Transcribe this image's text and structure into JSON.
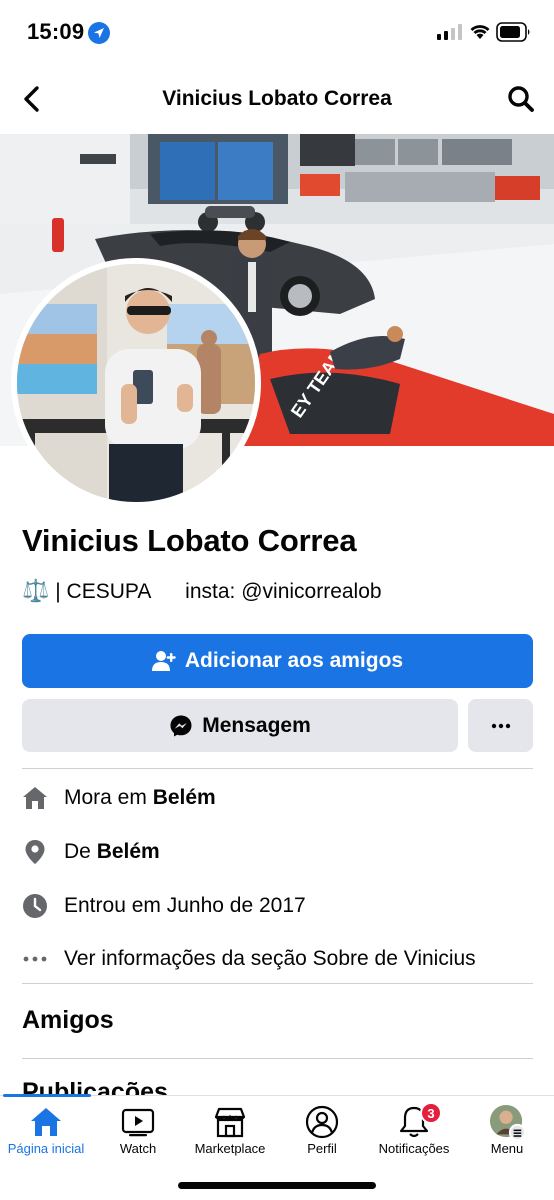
{
  "status_bar": {
    "time": "15:09"
  },
  "header": {
    "title": "Vinicius Lobato Correa"
  },
  "profile": {
    "name": "Vinicius Lobato Correa",
    "bio_emoji": "⚖️",
    "bio_text": " | CESUPA      insta: @vinicorrealob"
  },
  "actions": {
    "add_friend_label": "Adicionar aos amigos",
    "message_label": "Mensagem",
    "more_label": "···"
  },
  "details": [
    {
      "prefix": "Mora em ",
      "bold": "Belém",
      "icon": "home-icon"
    },
    {
      "prefix": "De ",
      "bold": "Belém",
      "icon": "location-pin-icon"
    },
    {
      "prefix": "Entrou em Junho de 2017",
      "bold": "",
      "icon": "clock-icon"
    },
    {
      "prefix": "Ver informações da seção Sobre de Vinicius",
      "bold": "",
      "icon": "ellipsis-icon"
    }
  ],
  "sections": {
    "friends_title": "Amigos",
    "posts_title": "Publicações"
  },
  "tabbar": {
    "items": [
      {
        "label": "Página inicial",
        "icon": "home-icon",
        "active": true
      },
      {
        "label": "Watch",
        "icon": "watch-icon",
        "active": false
      },
      {
        "label": "Marketplace",
        "icon": "marketplace-icon",
        "active": false
      },
      {
        "label": "Perfil",
        "icon": "profile-icon",
        "active": false
      },
      {
        "label": "Notificações",
        "icon": "bell-icon",
        "active": false,
        "badge": "3"
      },
      {
        "label": "Menu",
        "icon": "menu-avatar-icon",
        "active": false
      }
    ]
  },
  "colors": {
    "accent": "#1b74e4",
    "secondary_button": "#e4e6eb",
    "badge": "#e41e3f"
  }
}
